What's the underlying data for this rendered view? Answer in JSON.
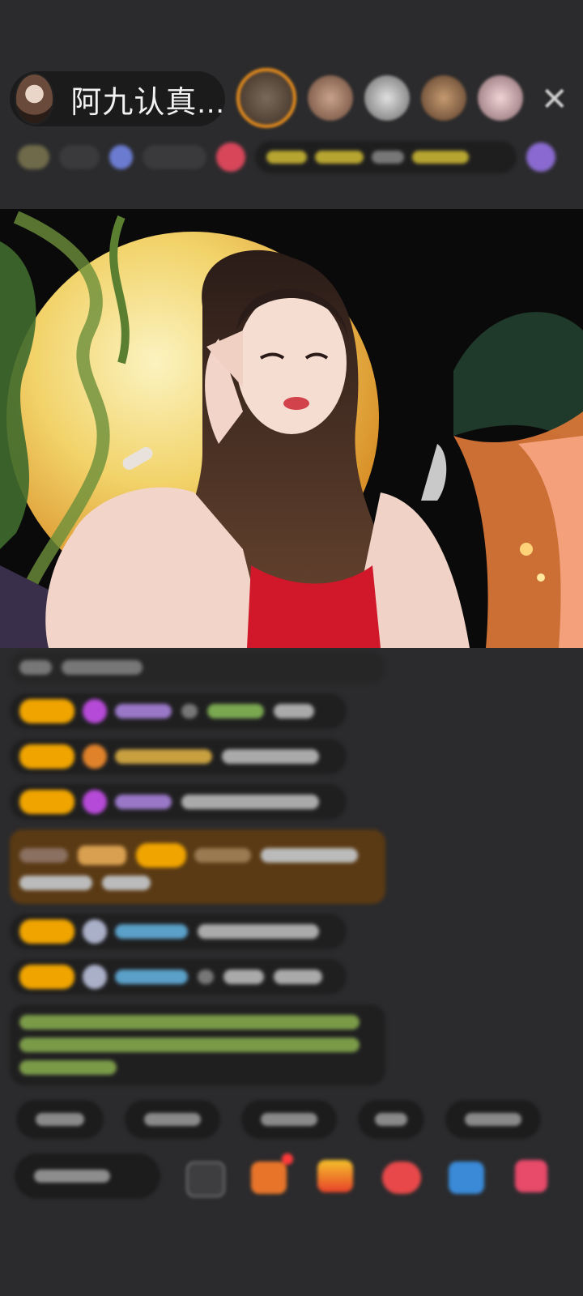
{
  "host": {
    "name": "阿九认真..."
  },
  "icons": {
    "close": "close-icon",
    "avatar": "avatar"
  },
  "colors": {
    "badge": "#f0a400",
    "background": "#2b2b2d",
    "gift_highlight": "#5a3a14"
  }
}
